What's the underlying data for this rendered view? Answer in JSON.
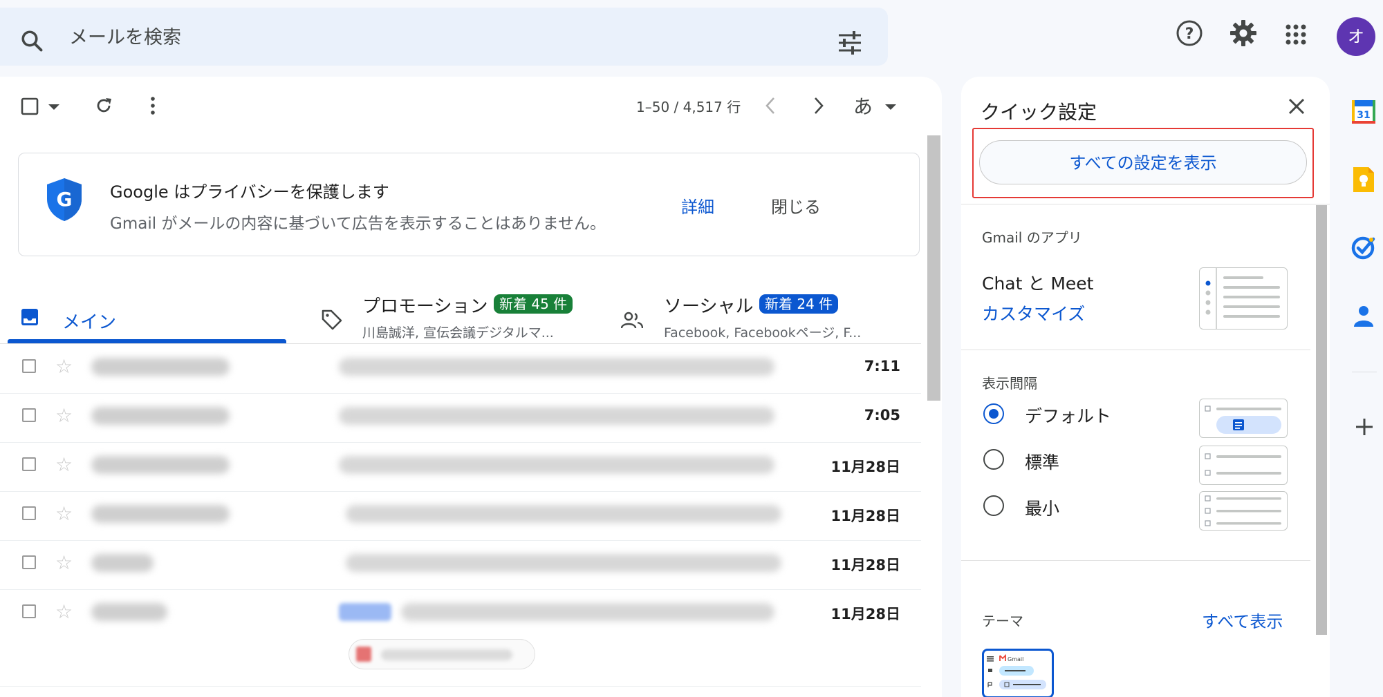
{
  "search": {
    "placeholder": "メールを検索"
  },
  "header": {
    "avatar_letter": "オ"
  },
  "toolbar": {
    "page_count": "1–50 / 4,517 行",
    "lang_label": "あ"
  },
  "privacy_card": {
    "title": "Google はプライバシーを保護します",
    "description": "Gmail がメールの内容に基づいて広告を表示することはありません。",
    "more_label": "詳細",
    "close_label": "閉じる"
  },
  "tabs": [
    {
      "label": "メイン",
      "sub": "",
      "badge": ""
    },
    {
      "label": "プロモーション",
      "sub": "川島誠洋, 宣伝会議デジタルマ...",
      "badge": "新着 45 件",
      "badge_color": "#188038"
    },
    {
      "label": "ソーシャル",
      "sub": "Facebook, Facebookページ, F...",
      "badge": "新着 24 件",
      "badge_color": "#0b57d0"
    }
  ],
  "emails": [
    {
      "time": "7:11"
    },
    {
      "time": "7:05"
    },
    {
      "time": "11月28日"
    },
    {
      "time": "11月28日"
    },
    {
      "time": "11月28日"
    },
    {
      "time": "11月28日"
    }
  ],
  "quick_settings": {
    "title": "クイック設定",
    "all_settings_label": "すべての設定を表示",
    "apps_section_label": "Gmail のアプリ",
    "apps_name": "Chat と Meet",
    "apps_customize": "カスタマイズ",
    "density_section_label": "表示間隔",
    "density_options": [
      {
        "label": "デフォルト",
        "selected": true
      },
      {
        "label": "標準",
        "selected": false
      },
      {
        "label": "最小",
        "selected": false
      }
    ],
    "theme_section_label": "テーマ",
    "theme_show_all": "すべて表示",
    "theme_thumb_brand": "Gmail"
  },
  "colors": {
    "accent": "#0b57d0",
    "highlight_box": "#e53935",
    "avatar": "#5e35b1"
  },
  "side_icons": [
    "calendar-icon",
    "keep-icon",
    "tasks-icon",
    "contacts-icon",
    "add-icon"
  ]
}
